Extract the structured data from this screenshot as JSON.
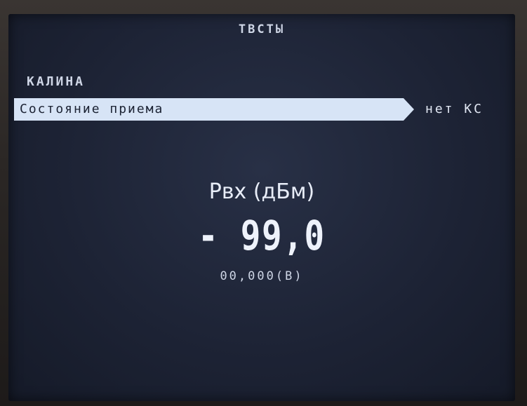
{
  "header": {
    "title": "ТВСТЫ"
  },
  "section": {
    "title": "КАЛИНА"
  },
  "menu": {
    "selected_item": {
      "label": "Состояние приема",
      "value": "нет КС"
    }
  },
  "reading": {
    "label": "Рвх (дБм)",
    "value": "- 99,0",
    "secondary": "00,000(В)"
  },
  "colors": {
    "screen_background": "#1d2335",
    "highlight": "#d7e4f6",
    "text": "#e2e8f4"
  }
}
